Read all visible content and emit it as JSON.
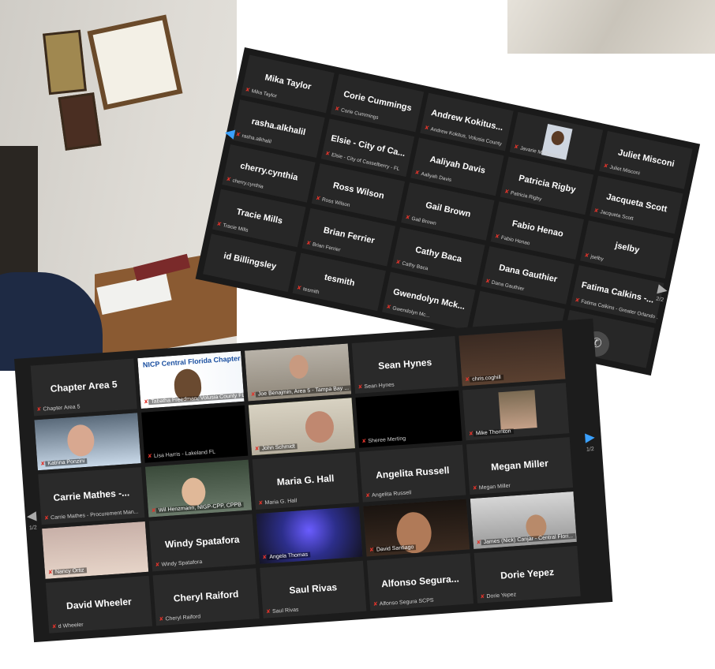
{
  "gridA": [
    {
      "name": "Mika Taylor",
      "sub": "Mika Taylor"
    },
    {
      "name": "Corie Cummings",
      "sub": "Corie Cummings"
    },
    {
      "name": "Andrew Kokitus...",
      "sub": "Andrew Kokitus, Volusia County"
    },
    {
      "name": "",
      "sub": "Javarie McDonald",
      "photo": true
    },
    {
      "name": "Juliet Misconi",
      "sub": "Juliet Misconi"
    },
    {
      "name": "rasha.alkhalil",
      "sub": "rasha.alkhalil"
    },
    {
      "name": "Elsie - City of Ca...",
      "sub": "Elsie - City of Casselberry - FL"
    },
    {
      "name": "Aaliyah Davis",
      "sub": "Aaliyah Davis"
    },
    {
      "name": "Patricia Rigby",
      "sub": "Patricia Rigby"
    },
    {
      "name": "Jacqueta Scott",
      "sub": "Jacqueta Scott"
    },
    {
      "name": "cherry.cynthia",
      "sub": "cherry.cynthia"
    },
    {
      "name": "Ross Wilson",
      "sub": "Ross Wilson"
    },
    {
      "name": "Gail Brown",
      "sub": "Gail Brown"
    },
    {
      "name": "Fabio Henao",
      "sub": "Fabio Henao"
    },
    {
      "name": "jselby",
      "sub": "jselby"
    },
    {
      "name": "Tracie Mills",
      "sub": "Tracie Mills"
    },
    {
      "name": "Brian Ferrier",
      "sub": "Brian Ferrier"
    },
    {
      "name": "Cathy Baca",
      "sub": "Cathy Baca"
    },
    {
      "name": "Dana Gauthier",
      "sub": "Dana Gauthier"
    },
    {
      "name": "Fatima Calkins -...",
      "sub": "Fatima Calkins - Greater Orlando ..."
    },
    {
      "name": "id Billingsley",
      "sub": ""
    },
    {
      "name": "tesmith",
      "sub": "tesmith"
    },
    {
      "name": "Gwendolyn Mck...",
      "sub": "Gwendolyn Mc..."
    },
    {
      "name": "",
      "sub": ""
    },
    {
      "name": "",
      "sub": ""
    }
  ],
  "gridB": [
    {
      "name": "Chapter Area 5",
      "sub": "Chapter Area 5"
    },
    {
      "name": "",
      "sub": "Tabatha Freedman, Volusia County FL",
      "video": "v-nicp",
      "logo": "NICP Central Florida Chapter"
    },
    {
      "name": "",
      "sub": "Joe Benajmin, Area 5 - Tampa Bay ...",
      "video": "v-office"
    },
    {
      "name": "Sean Hynes",
      "sub": "Sean Hynes"
    },
    {
      "name": "",
      "sub": "chris.coghill",
      "video": "v-dog1"
    },
    {
      "name": "",
      "sub": "Katrina Ponzini",
      "video": "v-woman"
    },
    {
      "name": "",
      "sub": "Lisa Harris - Lakeland FL",
      "blank": true
    },
    {
      "name": "",
      "sub": "John Schmidt",
      "video": "v-john"
    },
    {
      "name": "",
      "sub": "Sheree Merting",
      "blank": true
    },
    {
      "name": "",
      "sub": "Mike Thornton",
      "video": "v-mike"
    },
    {
      "name": "Carrie Mathes -...",
      "sub": "Carrie Mathes - Procurement Man..."
    },
    {
      "name": "",
      "sub": "Wil Henzmann, NIGP-CPP, CPPB",
      "video": "v-will"
    },
    {
      "name": "Maria G. Hall",
      "sub": "Maria G. Hall"
    },
    {
      "name": "Angelita Russell",
      "sub": "Angelita Russell"
    },
    {
      "name": "Megan Miller",
      "sub": "Megan Miller"
    },
    {
      "name": "",
      "sub": "Nancy Ortiz",
      "video": "v-nancy"
    },
    {
      "name": "Windy Spatafora",
      "sub": "Windy Spatafora"
    },
    {
      "name": "",
      "sub": "Angela Thomas",
      "video": "v-dog2"
    },
    {
      "name": "",
      "sub": "David Santiago",
      "video": "v-david"
    },
    {
      "name": "",
      "sub": "James (Nick) Canjar - Central Flori...",
      "video": "v-james"
    },
    {
      "name": "David Wheeler",
      "sub": "d Wheeler"
    },
    {
      "name": "Cheryl Raiford",
      "sub": "Cheryl Raiford"
    },
    {
      "name": "Saul Rivas",
      "sub": "Saul Rivas"
    },
    {
      "name": "Alfonso Segura...",
      "sub": "Alfonso Segura SCPS"
    },
    {
      "name": "Dorie Yepez",
      "sub": "Dorie Yepez"
    }
  ],
  "nav": {
    "next": "▶",
    "prev": "◀",
    "pageA": "2/2",
    "pageB": "1/2",
    "pageBLeft": "1/2"
  },
  "icons": {
    "mic_muted": "mic-muted-icon",
    "phone": "phone-icon"
  },
  "colors": {
    "accent": "#3aa0ff",
    "muted": "#e0342b",
    "highlight": "#c9e06a"
  }
}
